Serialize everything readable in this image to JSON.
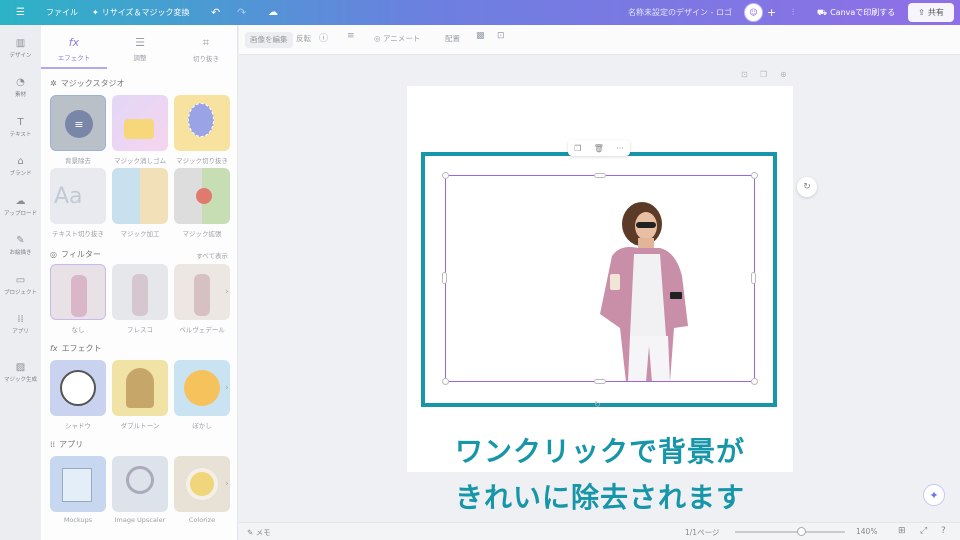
{
  "topbar": {
    "menu_icon": "hamburger-icon",
    "file_label": "ファイル",
    "resize_label": "リサイズ＆マジック変換",
    "doc_title": "名称未設定のデザイン - ロゴ",
    "print_label": "Canvaで印刷する",
    "share_label": "共有"
  },
  "rail": [
    {
      "label": "デザイン",
      "icon": "layout-icon"
    },
    {
      "label": "素材",
      "icon": "elements-icon"
    },
    {
      "label": "テキスト",
      "icon": "text-icon"
    },
    {
      "label": "ブランド",
      "icon": "brand-icon"
    },
    {
      "label": "アップロード",
      "icon": "upload-icon"
    },
    {
      "label": "お絵描き",
      "icon": "draw-icon"
    },
    {
      "label": "プロジェクト",
      "icon": "folder-icon"
    },
    {
      "label": "アプリ",
      "icon": "apps-icon"
    },
    {
      "label": "マジック生成",
      "icon": "magic-media-icon"
    }
  ],
  "panel": {
    "tabs": [
      {
        "label": "エフェクト",
        "icon": "fx"
      },
      {
        "label": "調整",
        "icon": "sliders"
      },
      {
        "label": "切り抜き",
        "icon": "crop"
      }
    ],
    "magic_studio": {
      "title": "マジックスタジオ",
      "items": [
        "背景除去",
        "マジック消しゴム",
        "マジック切り抜き",
        "テキスト切り抜き",
        "マジック加工",
        "マジック拡張"
      ]
    },
    "filters": {
      "title": "フィルター",
      "see_all": "すべて表示",
      "items": [
        "なし",
        "フレスコ",
        "ベルヴェデール"
      ]
    },
    "effects": {
      "title": "エフェクト",
      "items": [
        "シャドウ",
        "ダブルトーン",
        "ぼかし"
      ]
    },
    "apps": {
      "title": "アプリ",
      "items": [
        "Mockups",
        "Image Upscaler",
        "Colorize"
      ]
    }
  },
  "toolbar": {
    "edit_image": "画像を編集",
    "flip": "反転",
    "animate": "アニメート",
    "position": "配置"
  },
  "caption": {
    "line1": "ワンクリックで背景が",
    "line2": "きれいに除去されます"
  },
  "bottom": {
    "notes": "メモ",
    "page": "1/1ページ",
    "zoom": "140%",
    "zoom_fraction": 0.6
  },
  "colors": {
    "selection_teal": "#1696a8",
    "selection_purple": "#9e64e2",
    "caption": "#1796a9"
  }
}
